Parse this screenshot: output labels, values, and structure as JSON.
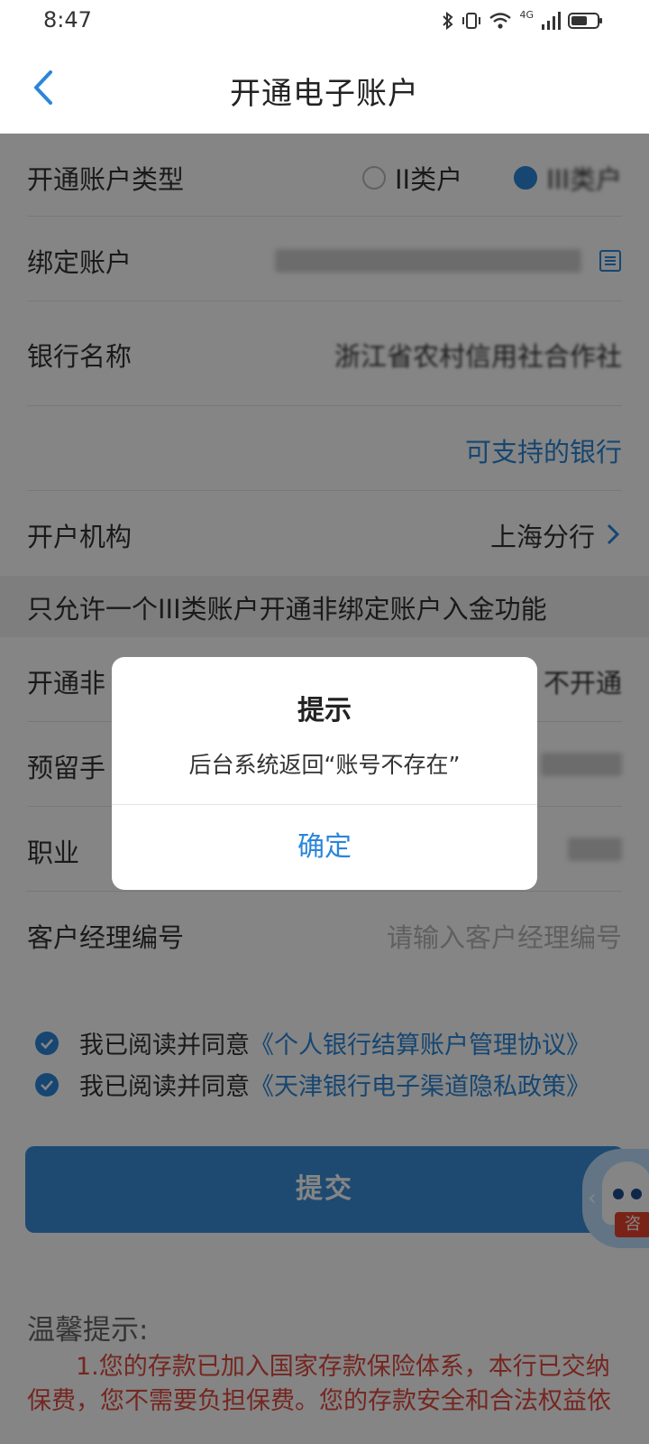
{
  "status_bar": {
    "time": "8:47",
    "network": "4G"
  },
  "header": {
    "title": "开通电子账户",
    "back_icon": "chevron-left-icon"
  },
  "form": {
    "account_type": {
      "label": "开通账户类型",
      "options": [
        "II类户",
        "III类户"
      ],
      "selected": "III类户"
    },
    "bound_account": {
      "label": "绑定账户",
      "value_visible": false
    },
    "bank_name": {
      "label": "银行名称",
      "value": "浙江省农村信用社合作社",
      "link": "可支持的银行"
    },
    "institution": {
      "label": "开户机构",
      "value": "上海分行"
    },
    "notice": "只允许一个III类账户开通非绑定账户入金功能",
    "non_bound_deposit": {
      "label": "开通非",
      "value": "不开通"
    },
    "phone": {
      "label": "预留手"
    },
    "occupation": {
      "label": "职业"
    },
    "manager_id": {
      "label": "客户经理编号",
      "placeholder": "请输入客户经理编号"
    }
  },
  "agreements": [
    {
      "prefix": "我已阅读并同意",
      "link": "《个人银行结算账户管理协议》",
      "checked": true
    },
    {
      "prefix": "我已阅读并同意",
      "link": "《天津银行电子渠道隐私政策》",
      "checked": true
    }
  ],
  "submit_label": "提交",
  "tips": {
    "title": "温馨提示:",
    "body": "1.您的存款已加入国家存款保险体系，本行已交纳保费，您不需要负担保费。您的存款安全和合法权益依"
  },
  "assistant": {
    "tag": "咨"
  },
  "dialog": {
    "title": "提示",
    "message": "后台系统返回“账号不存在”",
    "confirm_label": "确定"
  },
  "colors": {
    "accent": "#2b86d9",
    "tip_red": "#e04a3f",
    "overlay": "rgba(0,0,0,0.48)"
  }
}
